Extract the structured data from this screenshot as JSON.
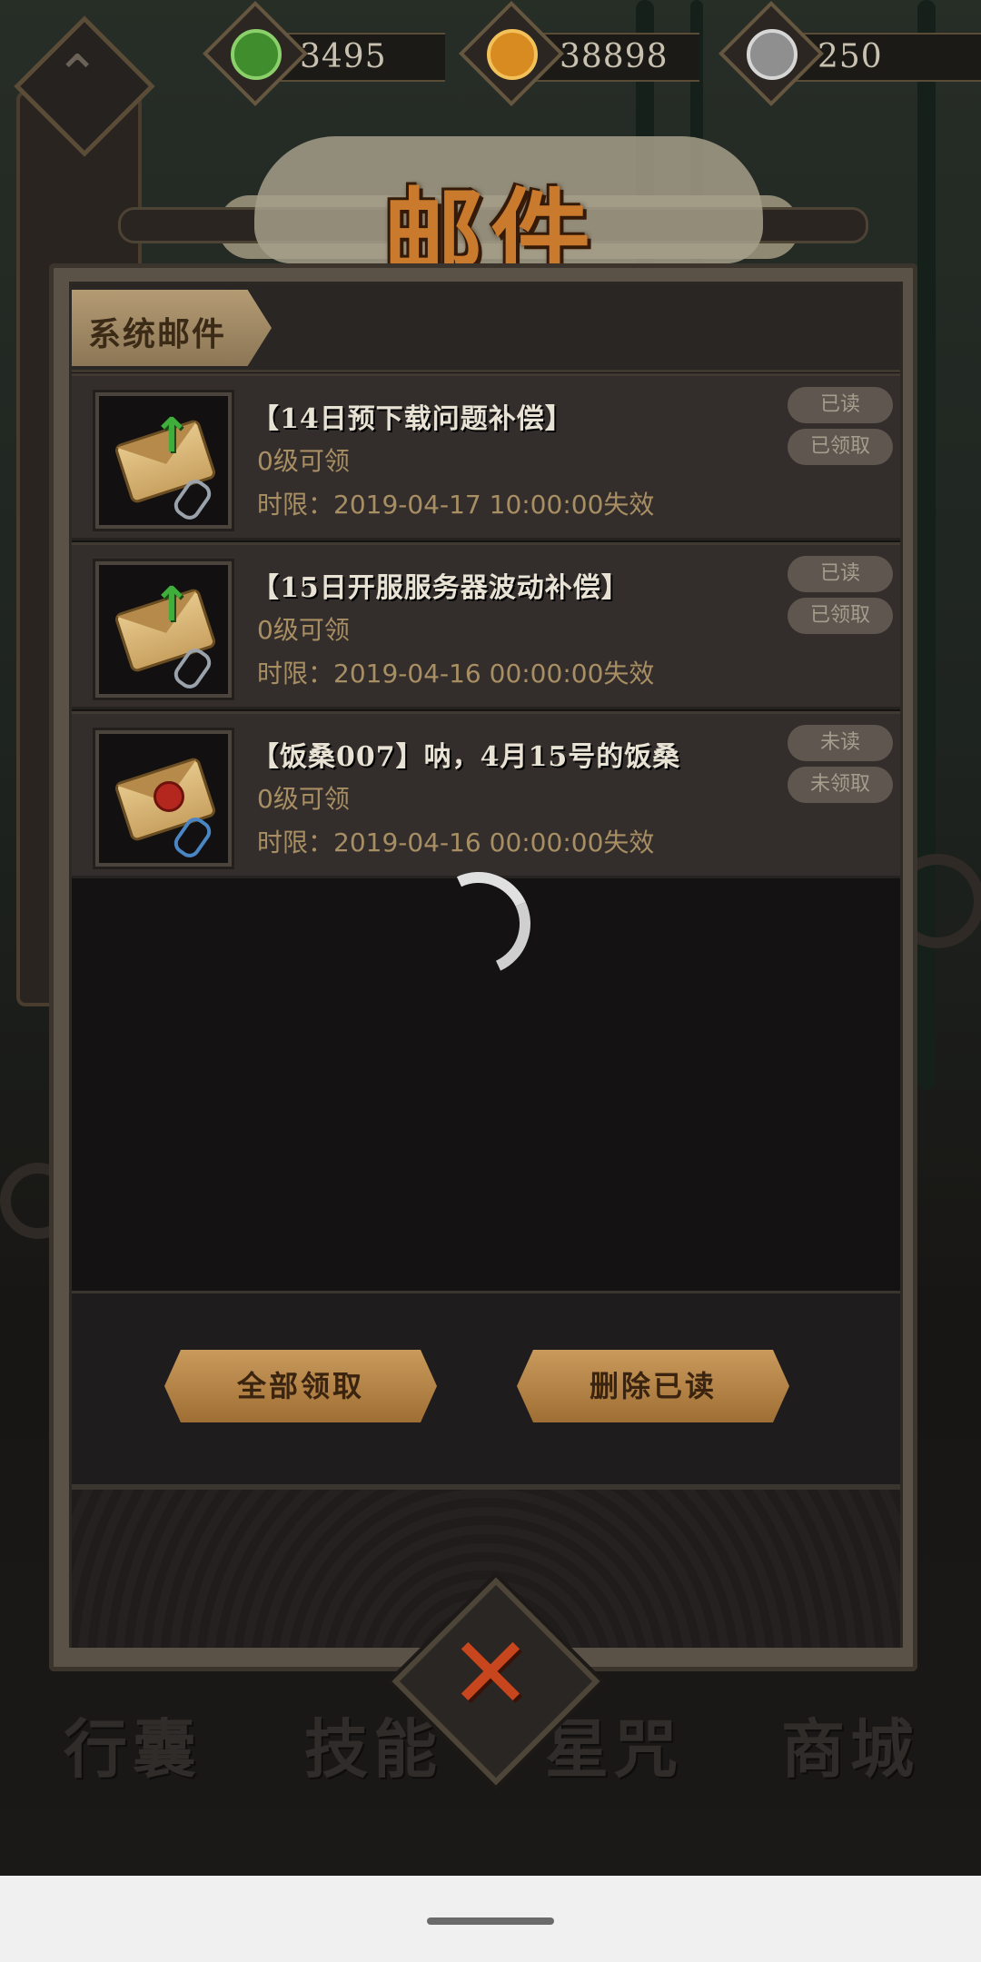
{
  "resources": [
    {
      "name": "jade-icon",
      "value": "3495",
      "color": "#4caf50"
    },
    {
      "name": "coin-icon",
      "value": "38898",
      "color": "#e8a234"
    },
    {
      "name": "silver-icon",
      "value": "250",
      "color": "#b8b8b8"
    }
  ],
  "title": "邮件",
  "tab": {
    "label": "系统邮件"
  },
  "mails": [
    {
      "title": "【14日预下载问题补偿】",
      "level": "0级可领",
      "expire": "时限：2019-04-17 10:00:00失效",
      "read_status": "已读",
      "claim_status": "已领取",
      "icon": "envelope-upgrade-icon"
    },
    {
      "title": "【15日开服服务器波动补偿】",
      "level": "0级可领",
      "expire": "时限：2019-04-16 00:00:00失效",
      "read_status": "已读",
      "claim_status": "已领取",
      "icon": "envelope-upgrade-icon"
    },
    {
      "title": "【饭桑007】呐，4月15号的饭桑",
      "level": "0级可领",
      "expire": "时限：2019-04-16 00:00:00失效",
      "read_status": "未读",
      "claim_status": "未领取",
      "icon": "envelope-sealed-icon"
    }
  ],
  "buttons": {
    "claim_all": "全部领取",
    "delete_read": "删除已读"
  },
  "bottom_nav": [
    "行囊",
    "技能",
    "星咒",
    "商城"
  ]
}
